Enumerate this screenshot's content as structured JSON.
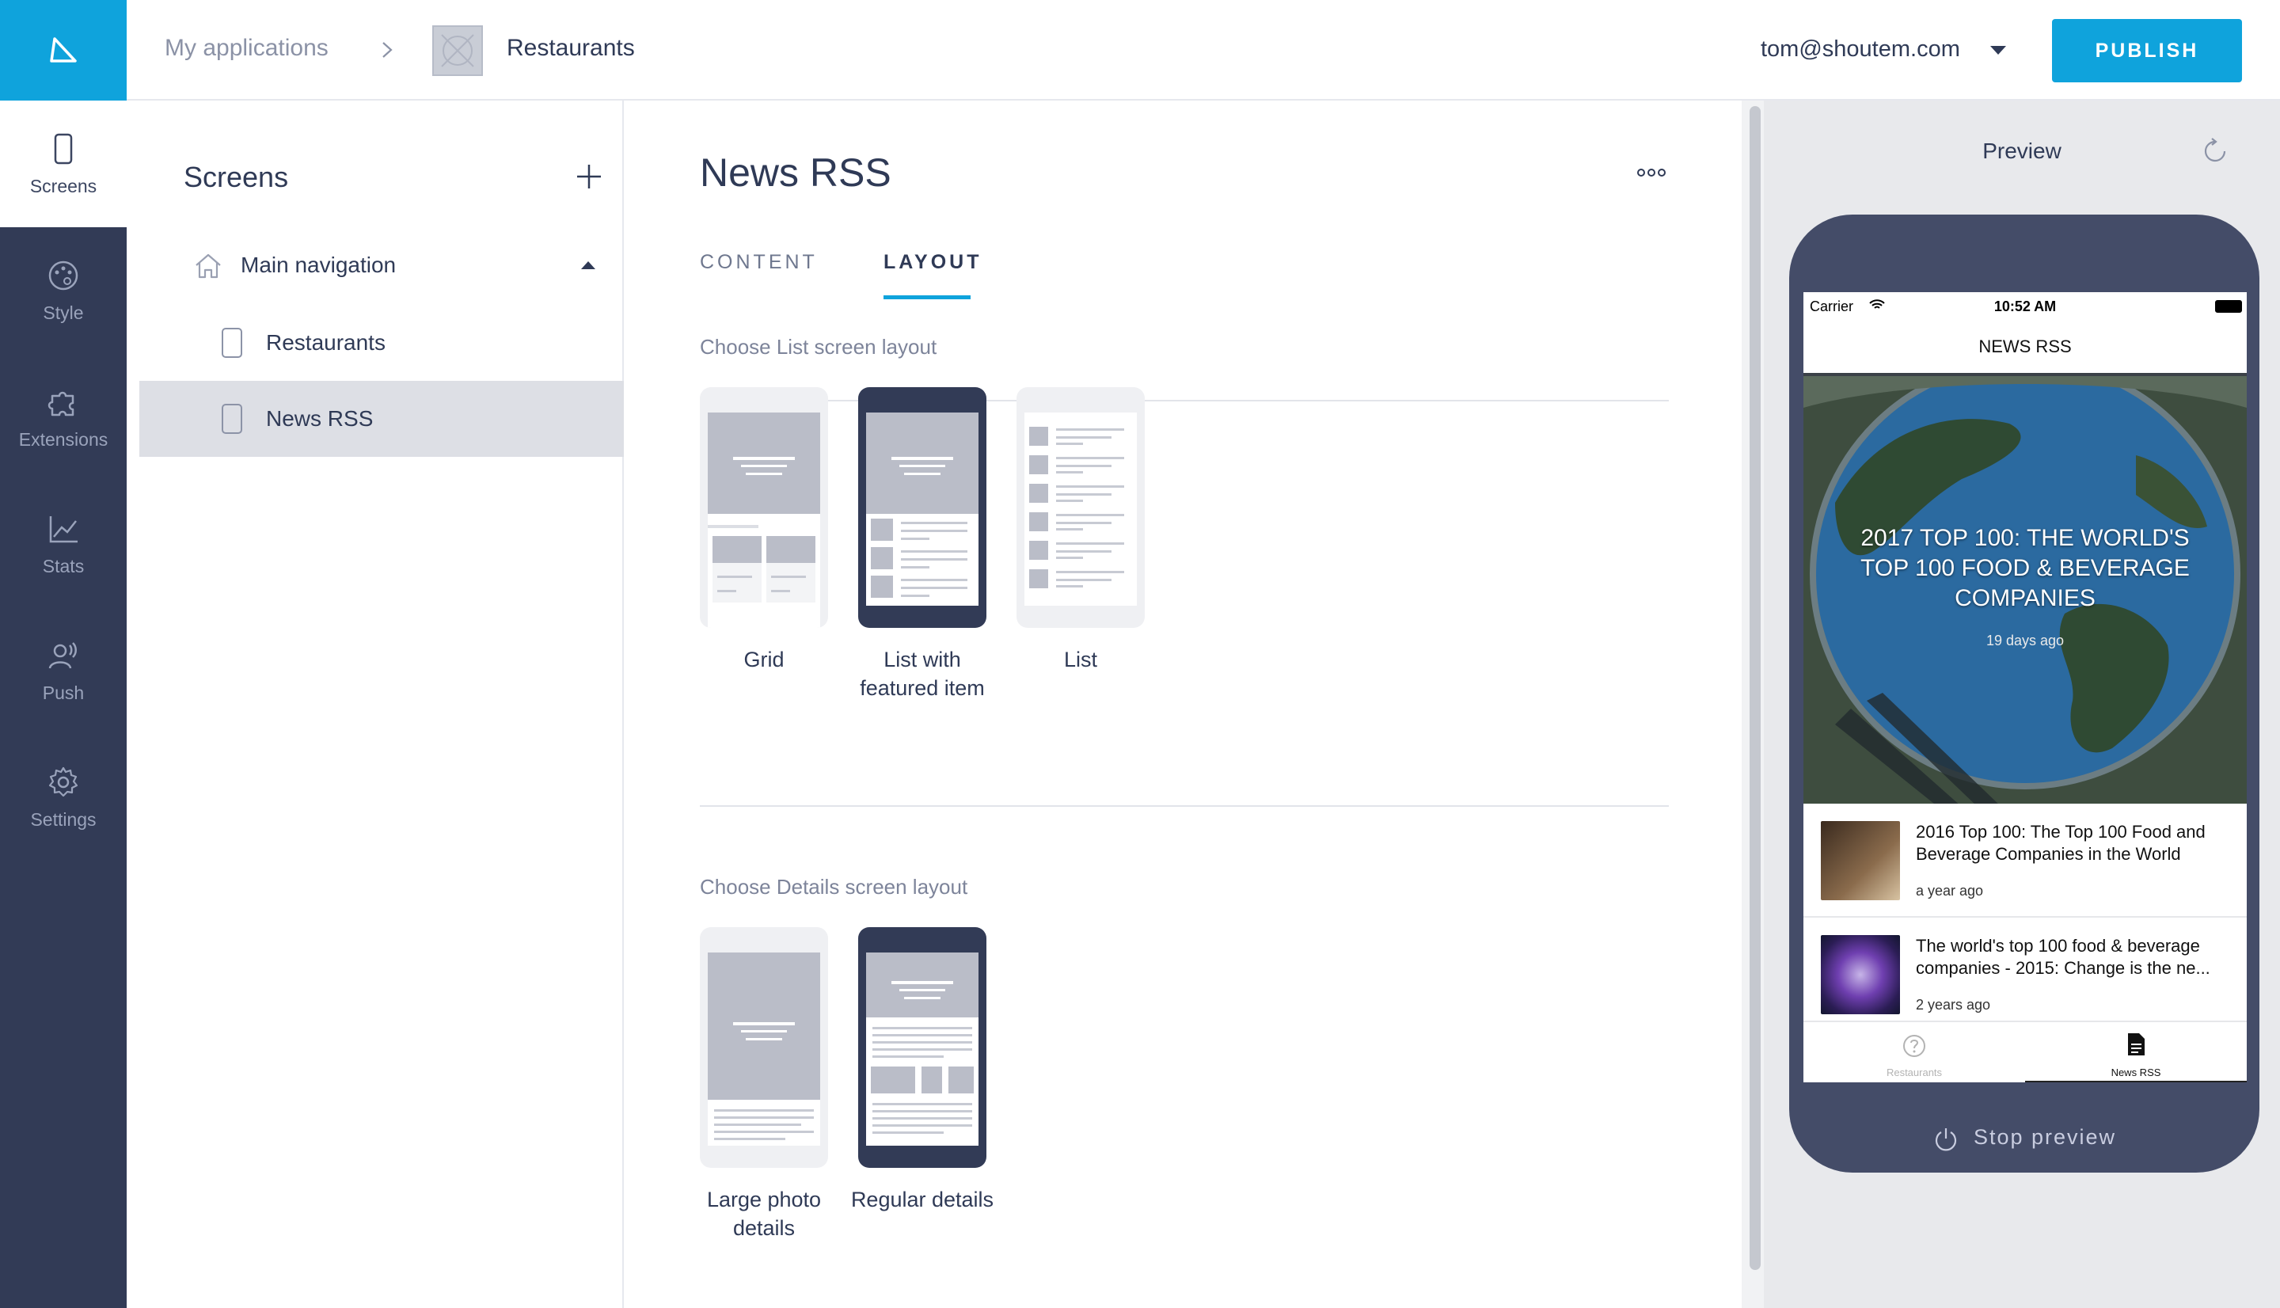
{
  "nav": {
    "logo_icon": "play-triangle-icon",
    "items": [
      {
        "label": "Screens",
        "icon": "phone-icon"
      },
      {
        "label": "Style",
        "icon": "palette-icon"
      },
      {
        "label": "Extensions",
        "icon": "puzzle-icon"
      },
      {
        "label": "Stats",
        "icon": "chart-icon"
      },
      {
        "label": "Push",
        "icon": "push-user-icon"
      },
      {
        "label": "Settings",
        "icon": "gear-icon"
      }
    ]
  },
  "topbar": {
    "breadcrumb_root": "My applications",
    "app_name": "Restaurants",
    "user_email": "tom@shoutem.com",
    "publish_label": "PUBLISH"
  },
  "screens": {
    "title": "Screens",
    "group_label": "Main navigation",
    "items": [
      {
        "label": "Restaurants"
      },
      {
        "label": "News RSS"
      }
    ]
  },
  "main": {
    "title": "News RSS",
    "tabs": [
      {
        "label": "CONTENT"
      },
      {
        "label": "LAYOUT"
      }
    ],
    "list_section_label": "Choose List screen layout",
    "list_layouts": [
      {
        "label": "Grid"
      },
      {
        "label": "List with featured item"
      },
      {
        "label": "List"
      }
    ],
    "details_section_label": "Choose Details screen layout",
    "details_layouts": [
      {
        "label": "Large photo details"
      },
      {
        "label": "Regular details"
      }
    ]
  },
  "preview": {
    "title": "Preview",
    "status_carrier": "Carrier",
    "status_time": "10:52 AM",
    "screen_title": "NEWS RSS",
    "featured": {
      "title": "2017 TOP 100: THE WORLD'S TOP 100 FOOD & BEVERAGE COMPANIES",
      "time": "19 days ago"
    },
    "articles": [
      {
        "title": "2016 Top 100: The Top 100 Food and Beverage Companies in the World",
        "time": "a year ago"
      },
      {
        "title": "The world's top 100 food & beverage companies - 2015: Change is the ne...",
        "time": "2 years ago"
      }
    ],
    "tabbar": [
      {
        "label": "Restaurants"
      },
      {
        "label": "News RSS"
      }
    ],
    "stop_label": "Stop preview"
  },
  "colors": {
    "accent": "#0fa3dc",
    "nav_bg": "#323b56",
    "phone_frame": "#444c68"
  }
}
